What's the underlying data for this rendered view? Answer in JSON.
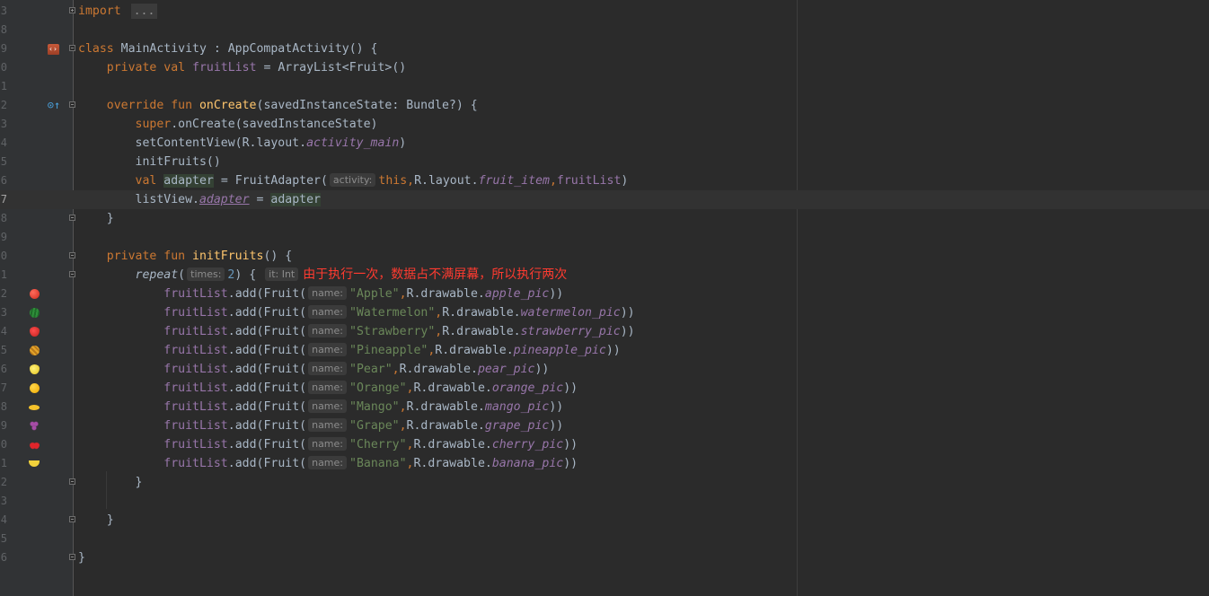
{
  "editor": {
    "lines": [
      {
        "n": "3",
        "icon": null,
        "fold": "plus",
        "tokens": [
          {
            "c": "kw",
            "t": "import"
          },
          {
            "c": "plain",
            "t": " "
          },
          {
            "c": "folded",
            "t": "..."
          }
        ]
      },
      {
        "n": "8",
        "icon": null,
        "fold": null,
        "tokens": []
      },
      {
        "n": "9",
        "icon": "android-icon",
        "fold": "minus",
        "tokens": [
          {
            "c": "kw",
            "t": "class "
          },
          {
            "c": "plain",
            "t": "MainActivity : AppCompatActivity() {"
          }
        ]
      },
      {
        "n": "0",
        "icon": null,
        "fold": null,
        "tokens": [
          {
            "c": "plain",
            "t": "    "
          },
          {
            "c": "kw",
            "t": "private val "
          },
          {
            "c": "prop",
            "t": "fruitList"
          },
          {
            "c": "plain",
            "t": " = ArrayList<Fruit>()"
          }
        ]
      },
      {
        "n": "1",
        "icon": null,
        "fold": null,
        "tokens": []
      },
      {
        "n": "2",
        "icon": "override-icon",
        "fold": "minus",
        "tokens": [
          {
            "c": "plain",
            "t": "    "
          },
          {
            "c": "kw",
            "t": "override fun "
          },
          {
            "c": "fn",
            "t": "onCreate"
          },
          {
            "c": "plain",
            "t": "(savedInstanceState: Bundle?) {"
          }
        ]
      },
      {
        "n": "3",
        "icon": null,
        "fold": null,
        "tokens": [
          {
            "c": "plain",
            "t": "        "
          },
          {
            "c": "kw",
            "t": "super"
          },
          {
            "c": "plain",
            "t": ".onCreate(savedInstanceState)"
          }
        ]
      },
      {
        "n": "4",
        "icon": null,
        "fold": null,
        "tokens": [
          {
            "c": "plain",
            "t": "        setContentView(R.layout."
          },
          {
            "c": "ital",
            "t": "activity_main"
          },
          {
            "c": "plain",
            "t": ")"
          }
        ]
      },
      {
        "n": "5",
        "icon": null,
        "fold": null,
        "tokens": [
          {
            "c": "plain",
            "t": "        initFruits()"
          }
        ]
      },
      {
        "n": "6",
        "icon": null,
        "fold": null,
        "tokens": [
          {
            "c": "plain",
            "t": "        "
          },
          {
            "c": "kw",
            "t": "val "
          },
          {
            "c": "plain hl",
            "t": "adapter"
          },
          {
            "c": "plain",
            "t": " = FruitAdapter("
          },
          {
            "c": "hint",
            "t": "activity:"
          },
          {
            "c": "kw",
            "t": "this"
          },
          {
            "c": "kw",
            "t": ","
          },
          {
            "c": "plain",
            "t": "R.layout."
          },
          {
            "c": "ital",
            "t": "fruit_item"
          },
          {
            "c": "kw",
            "t": ","
          },
          {
            "c": "prop",
            "t": "fruitList"
          },
          {
            "c": "plain",
            "t": ")"
          }
        ]
      },
      {
        "n": "7",
        "icon": null,
        "fold": null,
        "current": true,
        "tokens": [
          {
            "c": "plain",
            "t": "        listView."
          },
          {
            "c": "ital ul",
            "t": "adapter"
          },
          {
            "c": "plain",
            "t": " = "
          },
          {
            "c": "plain hl",
            "t": "adapter"
          }
        ]
      },
      {
        "n": "8",
        "icon": null,
        "fold": "minus",
        "tokens": [
          {
            "c": "plain",
            "t": "    }"
          }
        ]
      },
      {
        "n": "9",
        "icon": null,
        "fold": null,
        "tokens": []
      },
      {
        "n": "0",
        "icon": null,
        "fold": "minus",
        "tokens": [
          {
            "c": "plain",
            "t": "    "
          },
          {
            "c": "kw",
            "t": "private fun "
          },
          {
            "c": "fn",
            "t": "initFruits"
          },
          {
            "c": "plain",
            "t": "() {"
          }
        ]
      },
      {
        "n": "1",
        "icon": null,
        "fold": "minus",
        "tokens": [
          {
            "c": "plain",
            "t": "        "
          },
          {
            "c": "plain ital-plain",
            "t": "repeat"
          },
          {
            "c": "plain",
            "t": "("
          },
          {
            "c": "hint",
            "t": "times:"
          },
          {
            "c": "num",
            "t": "2"
          },
          {
            "c": "plain",
            "t": ") { "
          },
          {
            "c": "hint",
            "t": "it: Int"
          },
          {
            "c": "comment-cn",
            "t": "由于执行一次，数据占不满屏幕，所以执行两次"
          }
        ]
      },
      {
        "n": "2",
        "icon": "apple",
        "fold": null,
        "tokens": [
          {
            "c": "plain",
            "t": "            "
          },
          {
            "c": "prop",
            "t": "fruitList"
          },
          {
            "c": "plain",
            "t": ".add(Fruit("
          },
          {
            "c": "hint",
            "t": "name:"
          },
          {
            "c": "str",
            "t": "\"Apple\""
          },
          {
            "c": "kw",
            "t": ","
          },
          {
            "c": "plain",
            "t": "R.drawable."
          },
          {
            "c": "ital",
            "t": "apple_pic"
          },
          {
            "c": "plain",
            "t": "))"
          }
        ]
      },
      {
        "n": "3",
        "icon": "watermelon",
        "fold": null,
        "tokens": [
          {
            "c": "plain",
            "t": "            "
          },
          {
            "c": "prop",
            "t": "fruitList"
          },
          {
            "c": "plain",
            "t": ".add(Fruit("
          },
          {
            "c": "hint",
            "t": "name:"
          },
          {
            "c": "str",
            "t": "\"Watermelon\""
          },
          {
            "c": "kw",
            "t": ","
          },
          {
            "c": "plain",
            "t": "R.drawable."
          },
          {
            "c": "ital",
            "t": "watermelon_pic"
          },
          {
            "c": "plain",
            "t": "))"
          }
        ]
      },
      {
        "n": "4",
        "icon": "strawberry",
        "fold": null,
        "tokens": [
          {
            "c": "plain",
            "t": "            "
          },
          {
            "c": "prop",
            "t": "fruitList"
          },
          {
            "c": "plain",
            "t": ".add(Fruit("
          },
          {
            "c": "hint",
            "t": "name:"
          },
          {
            "c": "str",
            "t": "\"Strawberry\""
          },
          {
            "c": "kw",
            "t": ","
          },
          {
            "c": "plain",
            "t": "R.drawable."
          },
          {
            "c": "ital",
            "t": "strawberry_pic"
          },
          {
            "c": "plain",
            "t": "))"
          }
        ]
      },
      {
        "n": "5",
        "icon": "pineapple",
        "fold": null,
        "tokens": [
          {
            "c": "plain",
            "t": "            "
          },
          {
            "c": "prop",
            "t": "fruitList"
          },
          {
            "c": "plain",
            "t": ".add(Fruit("
          },
          {
            "c": "hint",
            "t": "name:"
          },
          {
            "c": "str",
            "t": "\"Pineapple\""
          },
          {
            "c": "kw",
            "t": ","
          },
          {
            "c": "plain",
            "t": "R.drawable."
          },
          {
            "c": "ital",
            "t": "pineapple_pic"
          },
          {
            "c": "plain",
            "t": "))"
          }
        ]
      },
      {
        "n": "6",
        "icon": "pear",
        "fold": null,
        "tokens": [
          {
            "c": "plain",
            "t": "            "
          },
          {
            "c": "prop",
            "t": "fruitList"
          },
          {
            "c": "plain",
            "t": ".add(Fruit("
          },
          {
            "c": "hint",
            "t": "name:"
          },
          {
            "c": "str",
            "t": "\"Pear\""
          },
          {
            "c": "kw",
            "t": ","
          },
          {
            "c": "plain",
            "t": "R.drawable."
          },
          {
            "c": "ital",
            "t": "pear_pic"
          },
          {
            "c": "plain",
            "t": "))"
          }
        ]
      },
      {
        "n": "7",
        "icon": "orange",
        "fold": null,
        "tokens": [
          {
            "c": "plain",
            "t": "            "
          },
          {
            "c": "prop",
            "t": "fruitList"
          },
          {
            "c": "plain",
            "t": ".add(Fruit("
          },
          {
            "c": "hint",
            "t": "name:"
          },
          {
            "c": "str",
            "t": "\"Orange\""
          },
          {
            "c": "kw",
            "t": ","
          },
          {
            "c": "plain",
            "t": "R.drawable."
          },
          {
            "c": "ital",
            "t": "orange_pic"
          },
          {
            "c": "plain",
            "t": "))"
          }
        ]
      },
      {
        "n": "8",
        "icon": "mango",
        "fold": null,
        "tokens": [
          {
            "c": "plain",
            "t": "            "
          },
          {
            "c": "prop",
            "t": "fruitList"
          },
          {
            "c": "plain",
            "t": ".add(Fruit("
          },
          {
            "c": "hint",
            "t": "name:"
          },
          {
            "c": "str",
            "t": "\"Mango\""
          },
          {
            "c": "kw",
            "t": ","
          },
          {
            "c": "plain",
            "t": "R.drawable."
          },
          {
            "c": "ital",
            "t": "mango_pic"
          },
          {
            "c": "plain",
            "t": "))"
          }
        ]
      },
      {
        "n": "9",
        "icon": "grape",
        "fold": null,
        "tokens": [
          {
            "c": "plain",
            "t": "            "
          },
          {
            "c": "prop",
            "t": "fruitList"
          },
          {
            "c": "plain",
            "t": ".add(Fruit("
          },
          {
            "c": "hint",
            "t": "name:"
          },
          {
            "c": "str",
            "t": "\"Grape\""
          },
          {
            "c": "kw",
            "t": ","
          },
          {
            "c": "plain",
            "t": "R.drawable."
          },
          {
            "c": "ital",
            "t": "grape_pic"
          },
          {
            "c": "plain",
            "t": "))"
          }
        ]
      },
      {
        "n": "0",
        "icon": "cherry",
        "fold": null,
        "tokens": [
          {
            "c": "plain",
            "t": "            "
          },
          {
            "c": "prop",
            "t": "fruitList"
          },
          {
            "c": "plain",
            "t": ".add(Fruit("
          },
          {
            "c": "hint",
            "t": "name:"
          },
          {
            "c": "str",
            "t": "\"Cherry\""
          },
          {
            "c": "kw",
            "t": ","
          },
          {
            "c": "plain",
            "t": "R.drawable."
          },
          {
            "c": "ital",
            "t": "cherry_pic"
          },
          {
            "c": "plain",
            "t": "))"
          }
        ]
      },
      {
        "n": "1",
        "icon": "banana",
        "fold": null,
        "tokens": [
          {
            "c": "plain",
            "t": "            "
          },
          {
            "c": "prop",
            "t": "fruitList"
          },
          {
            "c": "plain",
            "t": ".add(Fruit("
          },
          {
            "c": "hint",
            "t": "name:"
          },
          {
            "c": "str",
            "t": "\"Banana\""
          },
          {
            "c": "kw",
            "t": ","
          },
          {
            "c": "plain",
            "t": "R.drawable."
          },
          {
            "c": "ital",
            "t": "banana_pic"
          },
          {
            "c": "plain",
            "t": "))"
          }
        ]
      },
      {
        "n": "2",
        "icon": null,
        "fold": "minus",
        "tokens": [
          {
            "c": "plain",
            "t": "        }"
          }
        ]
      },
      {
        "n": "3",
        "icon": null,
        "fold": null,
        "tokens": []
      },
      {
        "n": "4",
        "icon": null,
        "fold": "minus",
        "tokens": [
          {
            "c": "plain",
            "t": "    }"
          }
        ]
      },
      {
        "n": "5",
        "icon": null,
        "fold": null,
        "tokens": []
      },
      {
        "n": "6",
        "icon": null,
        "fold": "minus",
        "tokens": [
          {
            "c": "plain",
            "t": "}"
          }
        ]
      }
    ]
  },
  "colors": {
    "background": "#2b2b2b",
    "gutter": "#313335",
    "keyword": "#cc7832",
    "property": "#9876aa",
    "function": "#ffc66d",
    "string": "#6a8759",
    "number": "#6897bb",
    "comment_red": "#ff3b30"
  }
}
